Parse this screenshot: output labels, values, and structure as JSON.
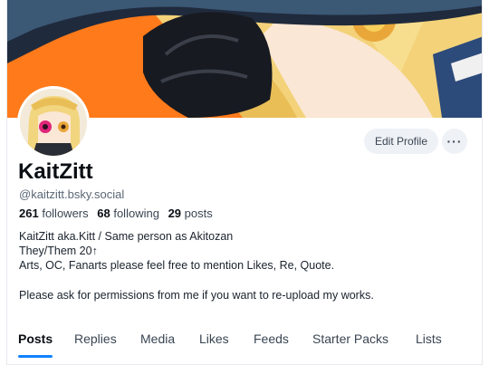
{
  "profile": {
    "display_name": "KaitZitt",
    "handle": "@kaitzitt.bsky.social",
    "followers_count": "261",
    "followers_label": "followers",
    "following_count": "68",
    "following_label": "following",
    "posts_count": "29",
    "posts_label": "posts",
    "bio_lines": [
      "KaitZitt aka.Kitt / Same person as Akitozan",
      "They/Them 20↑",
      "Arts, OC, Fanarts please feel free to mention Likes, Re, Quote.",
      "",
      "Please ask for permissions from me if you want to re-upload my works."
    ]
  },
  "actions": {
    "edit_profile_label": "Edit Profile",
    "more_label": "···"
  },
  "tabs": [
    {
      "label": "Posts",
      "active": true
    },
    {
      "label": "Replies",
      "active": false
    },
    {
      "label": "Media",
      "active": false
    },
    {
      "label": "Likes",
      "active": false
    },
    {
      "label": "Feeds",
      "active": false
    },
    {
      "label": "Starter Packs",
      "active": false
    },
    {
      "label": "Lists",
      "active": false
    }
  ],
  "colors": {
    "accent": "#1083fe",
    "banner_orange": "#ff7a1a",
    "button_bg": "#eef1f5"
  }
}
